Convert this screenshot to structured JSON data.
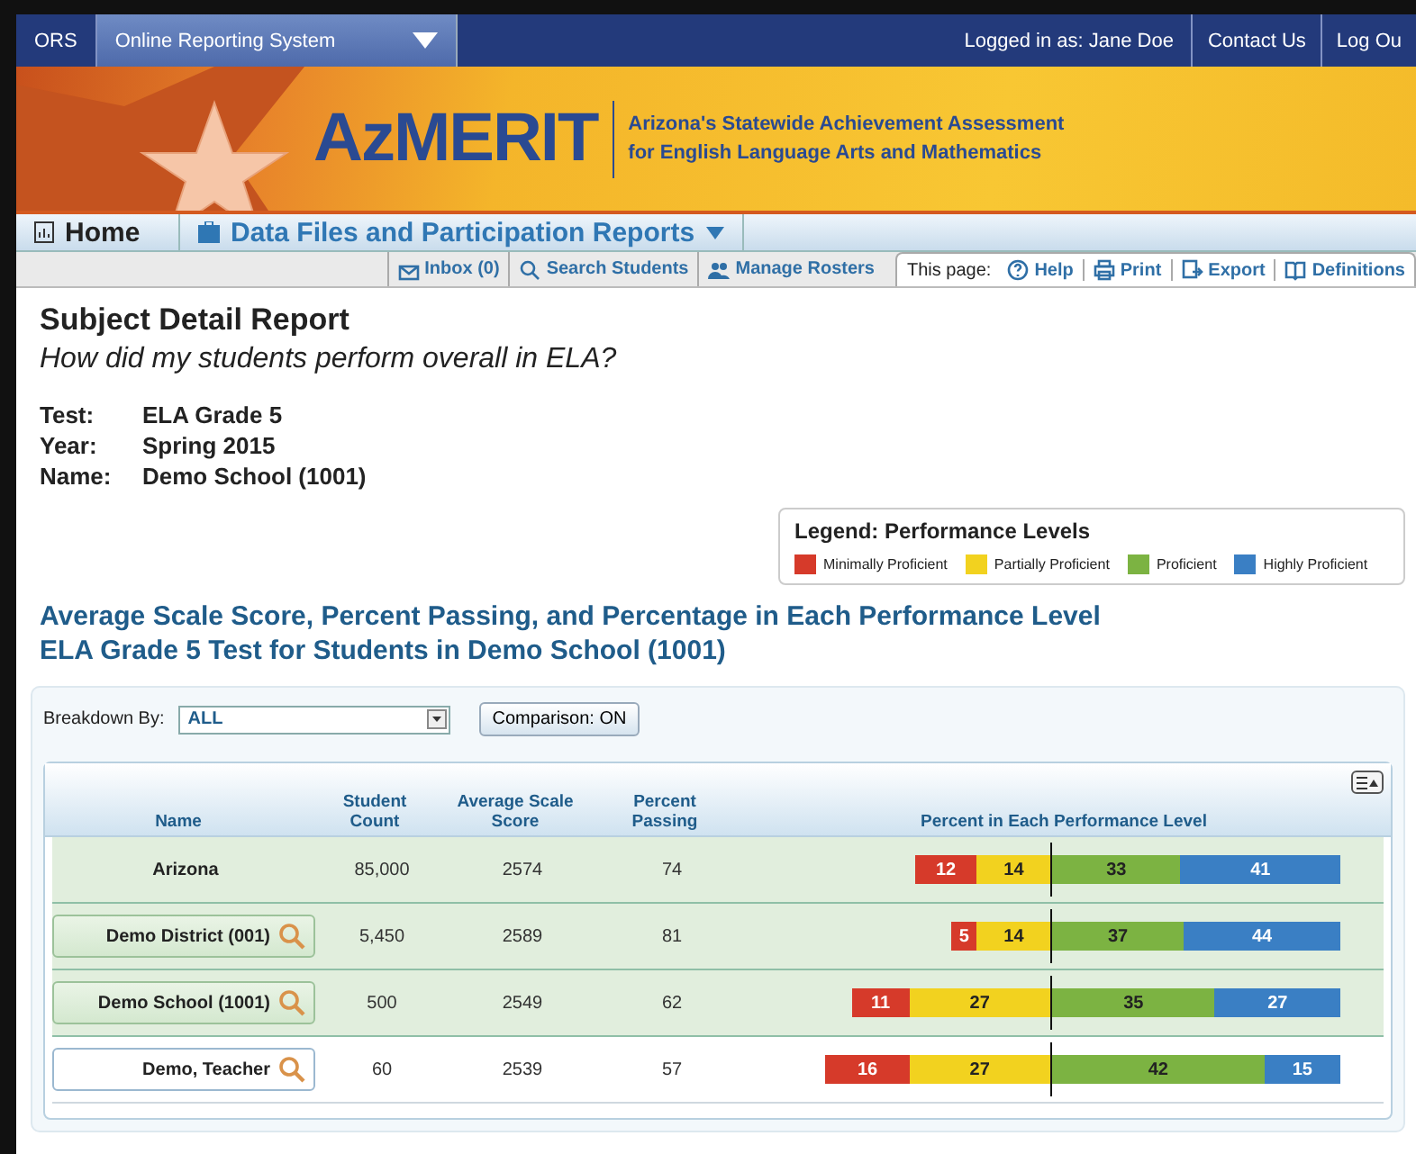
{
  "top_bar": {
    "short_name": "ORS",
    "system_menu": "Online Reporting System",
    "user": "Logged in as: Jane Doe",
    "links": [
      "Contact Us",
      "Log Ou"
    ]
  },
  "banner": {
    "title": "AzMERIT",
    "subtitle_1": "Arizona's Statewide Achievement Assessment",
    "subtitle_2": "for English Language Arts and Mathematics"
  },
  "nav": [
    {
      "label": "Home",
      "selected": false
    },
    {
      "label": "Data Files and Participation Reports",
      "selected": false
    }
  ],
  "toolbar": {
    "left": [
      {
        "label": "Inbox (0)",
        "kind": "inbox"
      },
      {
        "label": "Search Students",
        "kind": "search"
      },
      {
        "label": "Manage Rosters",
        "kind": "people"
      }
    ],
    "page_label": "This page:",
    "right": [
      {
        "label": "Help",
        "kind": "help"
      },
      {
        "label": "Print",
        "kind": "print"
      },
      {
        "label": "Export",
        "kind": "export"
      },
      {
        "label": "Definitions",
        "kind": "book"
      }
    ]
  },
  "report": {
    "title": "Subject Detail Report",
    "question": "How did my students perform overall in ELA?",
    "facts": [
      {
        "label": "Test:",
        "value": "ELA Grade 5"
      },
      {
        "label": "Year:",
        "value": "Spring 2015"
      },
      {
        "label": "Name:",
        "value": "Demo School (1001)"
      }
    ]
  },
  "legend": {
    "title": "Legend: Performance Levels",
    "items": [
      {
        "label": "Minimally Proficient",
        "color": "#d63a2a"
      },
      {
        "label": "Partially Proficient",
        "color": "#f2d21f"
      },
      {
        "label": "Proficient",
        "color": "#7cb342"
      },
      {
        "label": "Highly Proficient",
        "color": "#3a7fc4"
      }
    ]
  },
  "section": {
    "title_1": "Average Scale Score, Percent Passing, and Percentage in Each Performance Level",
    "title_2": "ELA Grade 5 Test for Students in Demo School (1001)"
  },
  "controls": {
    "breakdown_label": "Breakdown By:",
    "breakdown_value": "ALL",
    "comparison": "Comparison: ON"
  },
  "table": {
    "columns": [
      "Name",
      "Student Count",
      "Average Scale Score",
      "Percent Passing",
      "Percent in Each Performance Level"
    ],
    "rows": [
      {
        "kind": "label",
        "shaded": true,
        "name": "Arizona",
        "count": "85,000",
        "score": "2574",
        "passing": "74",
        "levels": [
          "12",
          "14",
          "33",
          "41"
        ]
      },
      {
        "kind": "button",
        "shaded": true,
        "name": "Demo District (001)",
        "count": "5,450",
        "score": "2589",
        "passing": "81",
        "levels": [
          "5",
          "14",
          "37",
          "44"
        ]
      },
      {
        "kind": "button",
        "shaded": true,
        "name": "Demo School (1001)",
        "count": "500",
        "score": "2549",
        "passing": "62",
        "levels": [
          "11",
          "27",
          "35",
          "27"
        ]
      },
      {
        "kind": "button",
        "shaded": false,
        "name": "Demo, Teacher",
        "count": "60",
        "score": "2539",
        "passing": "57",
        "levels": [
          "16",
          "27",
          "42",
          "15"
        ]
      }
    ]
  }
}
